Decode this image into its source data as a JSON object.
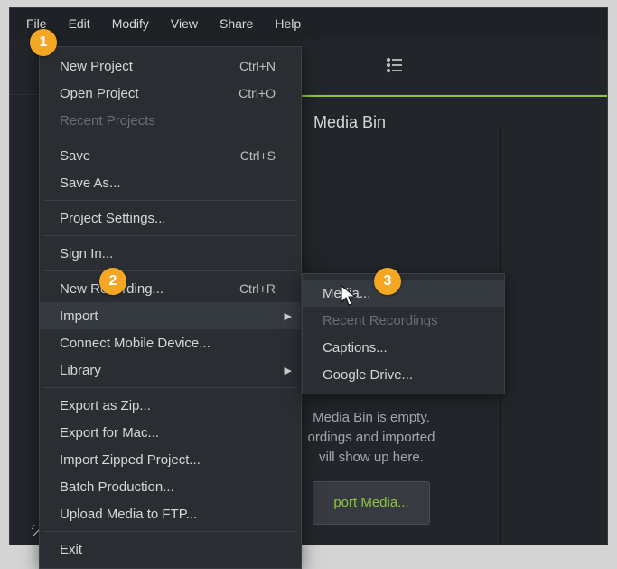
{
  "menubar": {
    "file": "File",
    "edit": "Edit",
    "modify": "Modify",
    "view": "View",
    "share": "Share",
    "help": "Help"
  },
  "file_menu": {
    "new_project": "New Project",
    "new_project_sc": "Ctrl+N",
    "open_project": "Open Project",
    "open_project_sc": "Ctrl+O",
    "recent_projects": "Recent Projects",
    "save": "Save",
    "save_sc": "Ctrl+S",
    "save_as": "Save As...",
    "project_settings": "Project Settings...",
    "sign_in": "Sign In...",
    "new_recording": "New Recording...",
    "new_recording_sc": "Ctrl+R",
    "import": "Import",
    "connect_mobile": "Connect Mobile Device...",
    "library": "Library",
    "export_zip": "Export as Zip...",
    "export_mac": "Export for Mac...",
    "import_zipped": "Import Zipped Project...",
    "batch_production": "Batch Production...",
    "upload_ftp": "Upload Media to FTP...",
    "exit": "Exit"
  },
  "import_submenu": {
    "media": "Media...",
    "recent_recordings": "Recent Recordings",
    "captions": "Captions...",
    "google_drive": "Google Drive..."
  },
  "media_bin": {
    "title": "Media Bin",
    "empty_line1": "Media Bin is empty.",
    "empty_line2": "ordings and imported",
    "empty_line3": "vill show up here.",
    "import_button": "port Media..."
  },
  "side": {
    "visual_effects": "Visual Effects"
  },
  "markers": {
    "m1": "1",
    "m2": "2",
    "m3": "3"
  }
}
